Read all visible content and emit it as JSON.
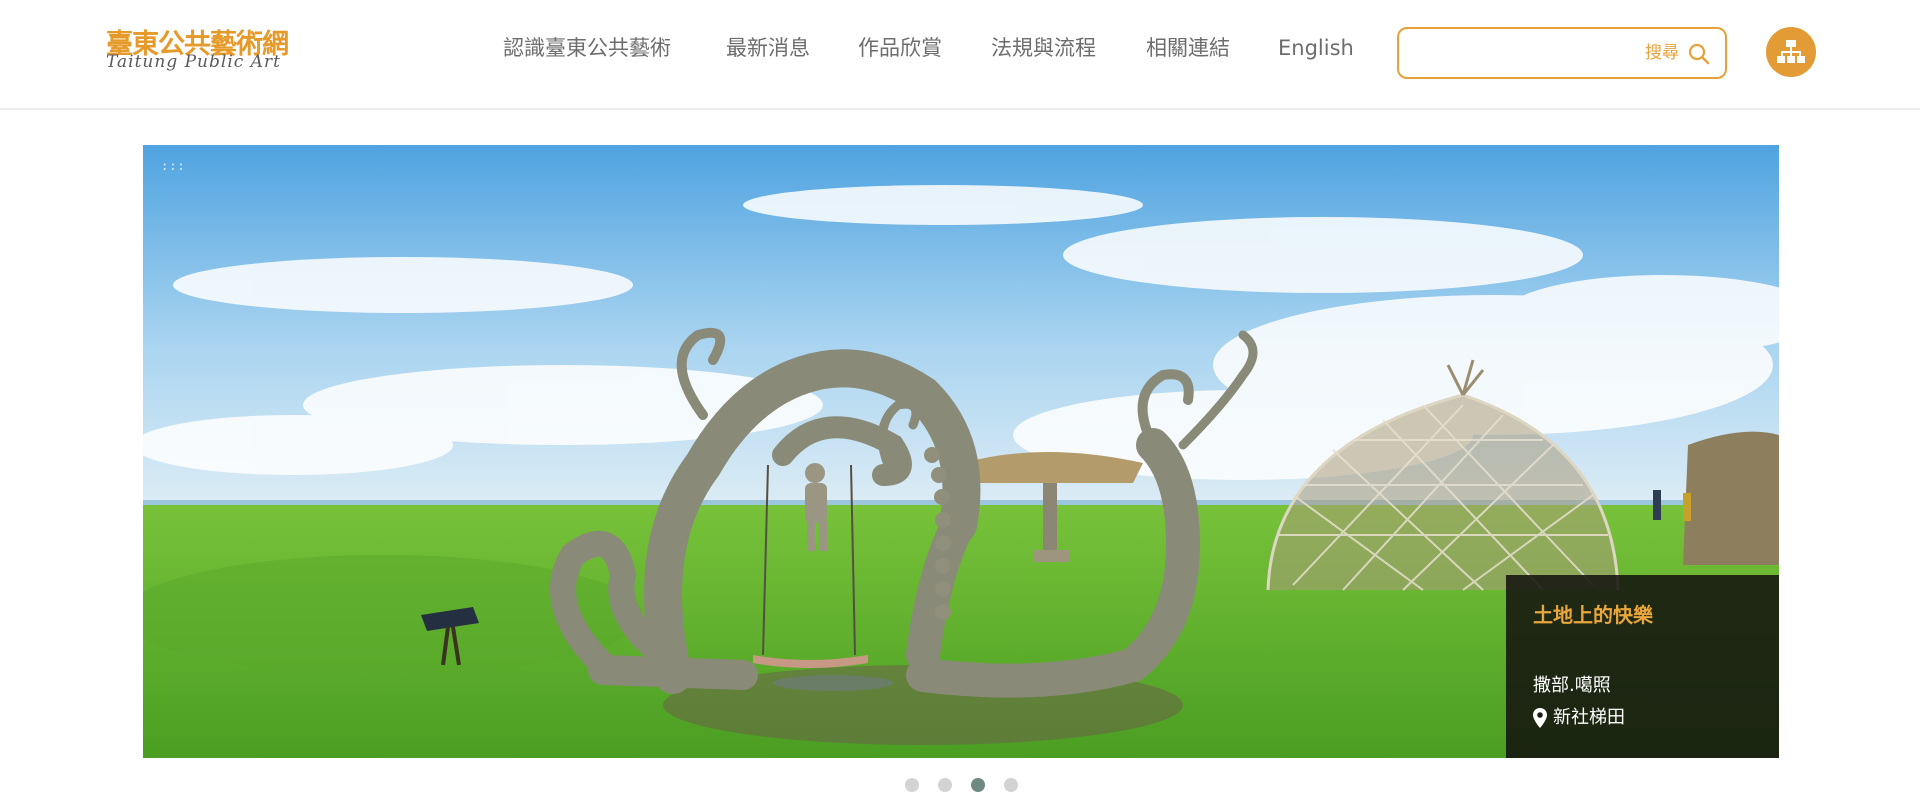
{
  "brand": {
    "title_cn": "臺東公共藝術網",
    "title_en": "Taitung Public Art"
  },
  "nav": {
    "items": [
      {
        "label": "認識臺東公共藝術"
      },
      {
        "label": "最新消息"
      },
      {
        "label": "作品欣賞"
      },
      {
        "label": "法規與流程"
      },
      {
        "label": "相關連結"
      },
      {
        "label": "English"
      }
    ]
  },
  "search": {
    "placeholder": "",
    "button_label": "搜尋",
    "icon": "search-icon"
  },
  "sitemap": {
    "icon": "sitemap-icon"
  },
  "hero": {
    "corner_mark": ":::",
    "caption": {
      "title": "土地上的快樂",
      "artist": "撒部.噶照",
      "location": "新社梯田",
      "location_icon": "map-pin-icon"
    }
  },
  "carousel": {
    "slide_count": 4,
    "active_index": 2
  },
  "colors": {
    "accent": "#e69a2a",
    "nav_text": "#6d6d6d",
    "dot_inactive": "#d3d3d3",
    "dot_active": "#6f8a82",
    "caption_bg": "#14140f"
  }
}
